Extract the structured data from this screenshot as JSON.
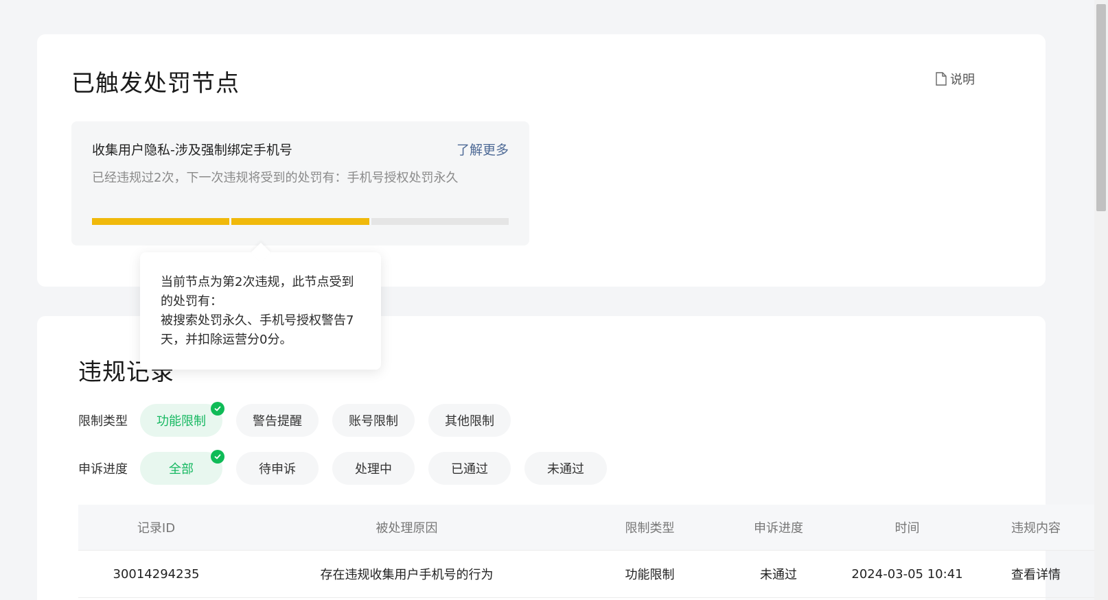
{
  "penalty_section": {
    "title": "已触发处罚节点",
    "help_label": "说明",
    "node": {
      "title": "收集用户隐私-涉及强制绑定手机号",
      "more_label": "了解更多",
      "description": "已经违规过2次，下一次违规将受到的处罚有：手机号授权处罚永久",
      "violations_count": 2,
      "total_nodes": 3
    },
    "tooltip": "当前节点为第2次违规，此节点受到\n的处罚有：\n被搜索处罚永久、手机号授权警告7\n天，并扣除运营分0分。"
  },
  "records_section": {
    "title": "违规记录",
    "filters": {
      "restriction": {
        "label": "限制类型",
        "options": [
          "功能限制",
          "警告提醒",
          "账号限制",
          "其他限制"
        ],
        "selected": "功能限制"
      },
      "appeal": {
        "label": "申诉进度",
        "options": [
          "全部",
          "待申诉",
          "处理中",
          "已通过",
          "未通过"
        ],
        "selected": "全部"
      }
    },
    "table": {
      "headers": [
        "记录ID",
        "被处理原因",
        "限制类型",
        "申诉进度",
        "时间",
        "违规内容"
      ],
      "rows": [
        {
          "id": "30014294235",
          "reason": "存在违规收集用户手机号的行为",
          "type": "功能限制",
          "appeal": "未通过",
          "time": "2024-03-05 10:41",
          "action": "查看详情"
        }
      ]
    }
  },
  "colors": {
    "accent_green": "#16b861",
    "link_blue": "#4e6a96",
    "progress_yellow": "#f0b90b"
  }
}
